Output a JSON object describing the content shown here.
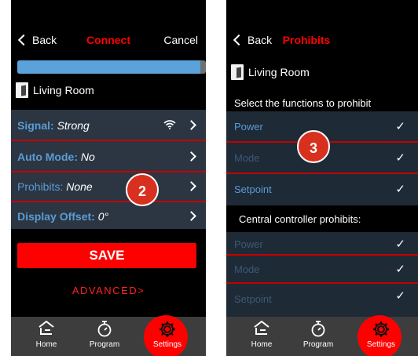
{
  "screen1": {
    "nav": {
      "back_label": "Back",
      "title": "Connect",
      "cancel_label": "Cancel"
    },
    "progress": {
      "percent": 97
    },
    "room_name": "Living Room",
    "settings": [
      {
        "label": "Signal:",
        "value": "Strong"
      },
      {
        "label": "Auto Mode:",
        "value": "No"
      },
      {
        "label": "Prohibits:",
        "value": "None"
      },
      {
        "label": "Display Offset:",
        "value": "0°"
      }
    ],
    "save_label": "SAVE",
    "advanced_label": "ADVANCED>",
    "badge": "2",
    "tabs": [
      {
        "label": "Home",
        "icon": "home-icon"
      },
      {
        "label": "Program",
        "icon": "stopwatch-icon"
      },
      {
        "label": "Settings",
        "icon": "gear-icon"
      }
    ]
  },
  "screen2": {
    "nav": {
      "back_label": "Back",
      "title": "Prohibits"
    },
    "room_name": "Living Room",
    "instruction": "Select the functions to prohibit",
    "functions": [
      "Power",
      "Mode",
      "Setpoint"
    ],
    "central_heading": "Central controller prohibits:",
    "central_functions": [
      "Power",
      "Mode",
      "Setpoint"
    ],
    "badge": "3",
    "tabs": [
      {
        "label": "Home",
        "icon": "home-icon"
      },
      {
        "label": "Program",
        "icon": "stopwatch-icon"
      },
      {
        "label": "Settings",
        "icon": "gear-icon"
      }
    ]
  },
  "colors": {
    "accent": "#ff0000",
    "label_blue": "#5b9bd5",
    "progress_blue": "#5aa2d9",
    "list_bg": "#2b3642",
    "badge": "#d8301f"
  }
}
